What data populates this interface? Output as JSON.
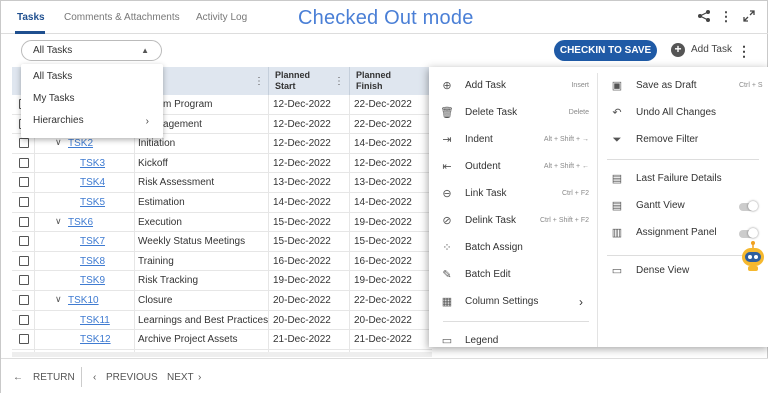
{
  "tabs": [
    {
      "label": "Tasks",
      "active": true
    },
    {
      "label": "Comments & Attachments",
      "active": false
    },
    {
      "label": "Activity Log",
      "active": false
    }
  ],
  "mode_title": "Checked Out mode",
  "header_icons": [
    "share-icon",
    "more-vertical-icon",
    "expand-icon"
  ],
  "toolbar": {
    "filter_value": "All Tasks",
    "checkin_label": "CHECKIN TO SAVE",
    "add_task_label": "Add Task"
  },
  "filter_menu": {
    "items": [
      "All Tasks",
      "My Tasks",
      "Hierarchies"
    ]
  },
  "table": {
    "columns": [
      "Planned Start",
      "Planned Finish"
    ],
    "rows": [
      {
        "id": "",
        "indent": 0,
        "expand": false,
        "name": "System Program",
        "start": "12-Dec-2022",
        "finish": "22-Dec-2022"
      },
      {
        "id": "",
        "indent": 0,
        "expand": false,
        "name": "t Management",
        "start": "12-Dec-2022",
        "finish": "22-Dec-2022"
      },
      {
        "id": "TSK2",
        "indent": 1,
        "expand": true,
        "name": "Initiation",
        "start": "12-Dec-2022",
        "finish": "14-Dec-2022"
      },
      {
        "id": "TSK3",
        "indent": 2,
        "expand": false,
        "name": "Kickoff",
        "start": "12-Dec-2022",
        "finish": "12-Dec-2022"
      },
      {
        "id": "TSK4",
        "indent": 2,
        "expand": false,
        "name": "Risk Assessment",
        "start": "13-Dec-2022",
        "finish": "13-Dec-2022"
      },
      {
        "id": "TSK5",
        "indent": 2,
        "expand": false,
        "name": "Estimation",
        "start": "14-Dec-2022",
        "finish": "14-Dec-2022"
      },
      {
        "id": "TSK6",
        "indent": 1,
        "expand": true,
        "name": "Execution",
        "start": "15-Dec-2022",
        "finish": "19-Dec-2022"
      },
      {
        "id": "TSK7",
        "indent": 2,
        "expand": false,
        "name": "Weekly Status Meetings",
        "start": "15-Dec-2022",
        "finish": "15-Dec-2022"
      },
      {
        "id": "TSK8",
        "indent": 2,
        "expand": false,
        "name": "Training",
        "start": "16-Dec-2022",
        "finish": "16-Dec-2022"
      },
      {
        "id": "TSK9",
        "indent": 2,
        "expand": false,
        "name": "Risk Tracking",
        "start": "19-Dec-2022",
        "finish": "19-Dec-2022"
      },
      {
        "id": "TSK10",
        "indent": 1,
        "expand": true,
        "name": "Closure",
        "start": "20-Dec-2022",
        "finish": "22-Dec-2022"
      },
      {
        "id": "TSK11",
        "indent": 2,
        "expand": false,
        "name": "Learnings and Best Practices",
        "start": "20-Dec-2022",
        "finish": "20-Dec-2022"
      },
      {
        "id": "TSK12",
        "indent": 2,
        "expand": false,
        "name": "Archive Project Assets",
        "start": "21-Dec-2022",
        "finish": "21-Dec-2022"
      }
    ]
  },
  "context_menu": {
    "left": [
      {
        "label": "Add Task",
        "shortcut": "Insert",
        "icon": "add-circle-icon"
      },
      {
        "label": "Delete Task",
        "shortcut": "Delete",
        "icon": "trash-icon"
      },
      {
        "label": "Indent",
        "shortcut": "Alt + Shift + →",
        "icon": "indent-icon"
      },
      {
        "label": "Outdent",
        "shortcut": "Alt + Shift + ←",
        "icon": "outdent-icon"
      },
      {
        "label": "Link Task",
        "shortcut": "Ctrl + F2",
        "icon": "link-icon"
      },
      {
        "label": "Delink Task",
        "shortcut": "Ctrl + Shift + F2",
        "icon": "unlink-icon"
      },
      {
        "label": "Batch Assign",
        "shortcut": "",
        "icon": "batch-assign-icon"
      },
      {
        "label": "Batch Edit",
        "shortcut": "",
        "icon": "batch-edit-icon"
      },
      {
        "label": "Column Settings",
        "shortcut": "",
        "icon": "columns-icon"
      },
      {
        "label": "Legend",
        "shortcut": "",
        "icon": "legend-icon"
      }
    ],
    "right": [
      {
        "label": "Save as Draft",
        "shortcut": "Ctrl + S",
        "icon": "save-icon"
      },
      {
        "label": "Undo All Changes",
        "shortcut": "",
        "icon": "undo-icon"
      },
      {
        "label": "Remove Filter",
        "shortcut": "",
        "icon": "remove-filter-icon"
      },
      {
        "label": "Last Failure Details",
        "shortcut": "",
        "icon": "failure-details-icon"
      },
      {
        "label": "Gantt View",
        "shortcut": "",
        "icon": "gantt-icon"
      },
      {
        "label": "Assignment Panel",
        "shortcut": "",
        "icon": "assignment-panel-icon"
      },
      {
        "label": "Dense View",
        "shortcut": "",
        "icon": "dense-view-icon"
      }
    ]
  },
  "footer": {
    "return_label": "RETURN",
    "previous_label": "PREVIOUS",
    "next_label": "NEXT"
  },
  "colors": {
    "accent": "#1f5aa6",
    "link": "#3f7bd1",
    "mode_title": "#4a7fd6",
    "header_bg": "#dfe6ef"
  }
}
